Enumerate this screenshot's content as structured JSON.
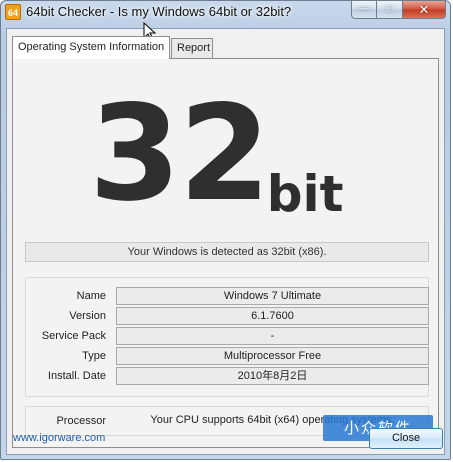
{
  "window": {
    "icon_text": "64",
    "title": "64bit Checker - Is my Windows 64bit or 32bit?",
    "controls": {
      "minimize": "—",
      "maximize": "□",
      "close": "✕"
    }
  },
  "tabs": [
    {
      "label": "Operating System Information",
      "active": true
    },
    {
      "label": "Report",
      "active": false
    }
  ],
  "result": {
    "number": "32",
    "unit": "bit",
    "status": "Your Windows is detected as 32bit (x86)."
  },
  "system_info": [
    {
      "label": "Name",
      "value": "Windows 7 Ultimate"
    },
    {
      "label": "Version",
      "value": "6.1.7600"
    },
    {
      "label": "Service Pack",
      "value": "-"
    },
    {
      "label": "Type",
      "value": "Multiprocessor Free"
    },
    {
      "label": "Install. Date",
      "value": "2010年8月2日"
    }
  ],
  "processor": {
    "label": "Processor",
    "value": "Your CPU supports 64bit (x64) operating systems."
  },
  "footer": {
    "link": "www.igorware.com",
    "close_label": "Close"
  },
  "watermark": "小众软件"
}
